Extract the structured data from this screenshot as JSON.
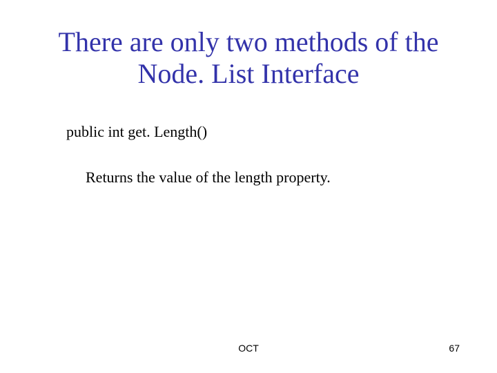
{
  "slide": {
    "title": "There are only two methods of the Node. List Interface",
    "method_signature": "public int get. Length()",
    "method_description": "Returns the value of the length property."
  },
  "footer": {
    "center": "OCT",
    "page_number": "67"
  }
}
